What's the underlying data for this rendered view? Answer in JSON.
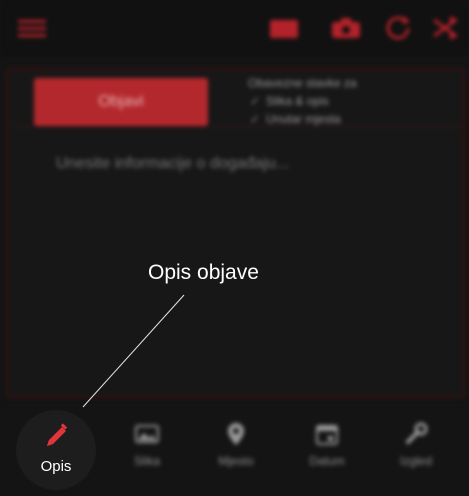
{
  "header": {
    "icons": [
      "menu-icon",
      "image-icon",
      "camera-icon",
      "refresh-icon",
      "shuffle-icon"
    ]
  },
  "editor": {
    "publish_label": "Objavi",
    "share_title": "Obavezne stavke za",
    "share_options": [
      "Slika & opis",
      "Unutar mjesta"
    ],
    "description_placeholder": "Unesite informacije o događaju..."
  },
  "nav": {
    "active": {
      "label": "Opis",
      "icon": "pencil-icon"
    },
    "items": [
      {
        "label": "Slika",
        "icon": "image-icon"
      },
      {
        "label": "Mjesto",
        "icon": "location-pin-icon"
      },
      {
        "label": "Datum",
        "icon": "calendar-icon"
      },
      {
        "label": "Izgled",
        "icon": "wrench-icon"
      }
    ]
  },
  "annotation": {
    "text": "Opis objave"
  },
  "colors": {
    "background": "#141414",
    "accent": "#b3282d",
    "active_icon": "#e0353b"
  }
}
